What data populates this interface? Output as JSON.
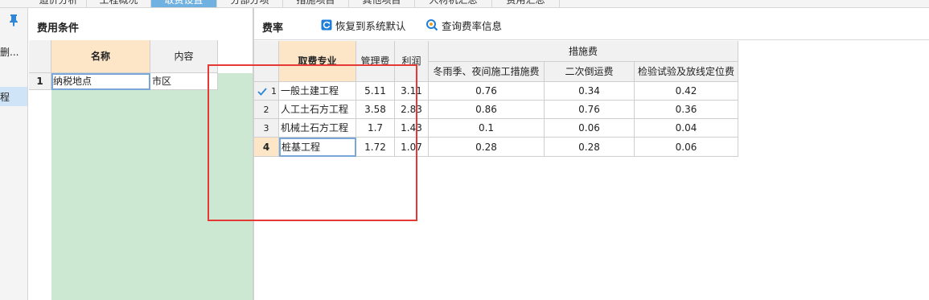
{
  "tabs": [
    "造价分析",
    "工程概况",
    "取费设置",
    "分部分项",
    "措施项目",
    "其他项目",
    "人材机汇总",
    "费用汇总"
  ],
  "leftnav": {
    "item1": "删...",
    "item2": "程"
  },
  "left_panel": {
    "title": "费用条件",
    "columns": [
      "名称",
      "内容"
    ],
    "rows": [
      {
        "index": "1",
        "name": "纳税地点",
        "value": "市区"
      }
    ]
  },
  "right_panel": {
    "title": "费率",
    "restore_button": "恢复到系统默认",
    "query_button": "查询费率信息",
    "headers": {
      "specialty": "取费专业",
      "management": "管理费",
      "profit": "利润",
      "measures": "措施费",
      "winter": "冬雨季、夜间施工措施费",
      "secondary": "二次倒运费",
      "inspection": "检验试验及放线定位费"
    },
    "rows": [
      {
        "index": "1",
        "name": "一般土建工程",
        "management": "5.11",
        "profit": "3.11",
        "winter": "0.76",
        "secondary": "0.34",
        "inspection": "0.42"
      },
      {
        "index": "2",
        "name": "人工土石方工程",
        "management": "3.58",
        "profit": "2.83",
        "winter": "0.86",
        "secondary": "0.76",
        "inspection": "0.36"
      },
      {
        "index": "3",
        "name": "机械土石方工程",
        "management": "1.7",
        "profit": "1.43",
        "winter": "0.1",
        "secondary": "0.06",
        "inspection": "0.04"
      },
      {
        "index": "4",
        "name": "桩基工程",
        "management": "1.72",
        "profit": "1.07",
        "winter": "0.28",
        "secondary": "0.28",
        "inspection": "0.06"
      }
    ]
  },
  "colors": {
    "accent": "#6fb1e0",
    "header_orange": "#fde5c8",
    "green_fill": "#cde8d2",
    "annotation_red": "#e53935",
    "button_blue": "#1f7fd8"
  }
}
